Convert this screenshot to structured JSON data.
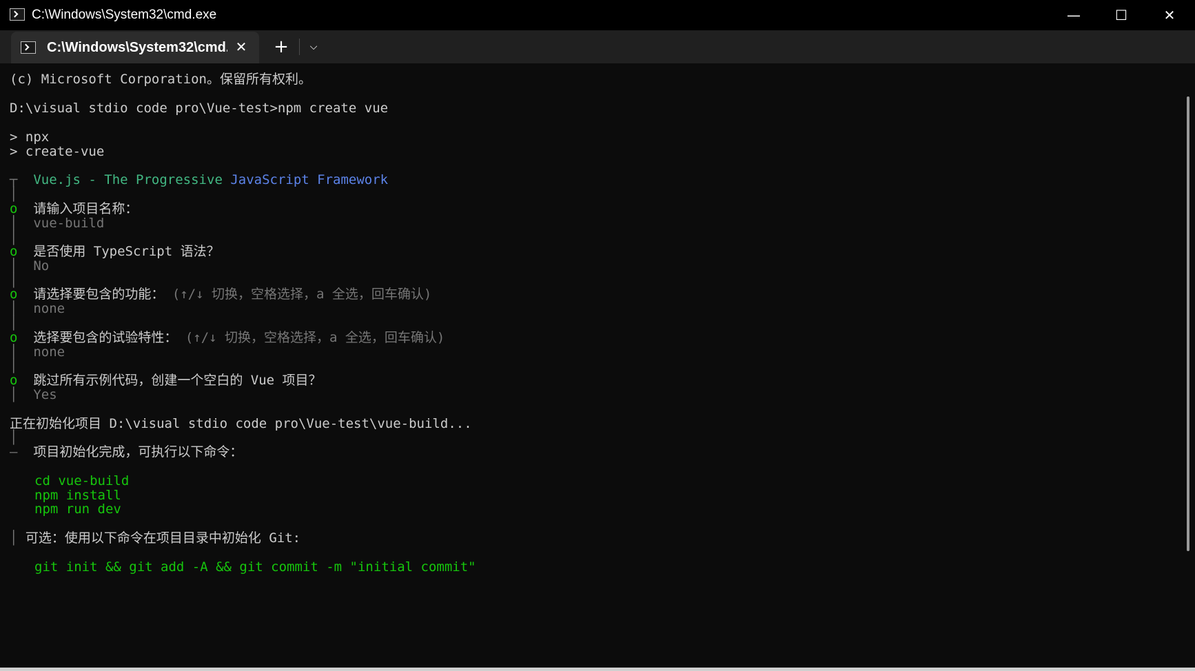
{
  "window": {
    "title": "C:\\Windows\\System32\\cmd.exe",
    "icon": "terminal-icon",
    "minimize_glyph": "—",
    "maximize_glyph": "☐",
    "close_glyph": "✕"
  },
  "tabs": {
    "active": {
      "label": "C:\\Windows\\System32\\cmd.exe",
      "icon": "terminal-icon",
      "close_glyph": "✕"
    },
    "new_tab_glyph": "+",
    "dropdown_glyph": "⌵"
  },
  "colors": {
    "background": "#0c0c0c",
    "text": "#cccccc",
    "green": "#16c60c",
    "dim": "#767676",
    "vue_green": "#42b883",
    "vue_blue": "#5c83e8"
  },
  "terminal": {
    "copyright": "(c) Microsoft Corporation。保留所有权利。",
    "prompt": "D:\\visual stdio code pro\\Vue-test>npm create vue",
    "npx_line1": "> npx",
    "npx_line2": "> create-vue",
    "banner_prefix": "┬ ",
    "banner_a": "Vue.js - The Progressive ",
    "banner_b": "JavaScript Framework",
    "bar": "│",
    "bullet": "o",
    "q1": "请输入项目名称：",
    "a1": "vue-build",
    "q2": "是否使用 TypeScript 语法？",
    "a2": "No",
    "q3": "请选择要包含的功能：",
    "q3_hint": "(↑/↓ 切换，空格选择，a 全选，回车确认)",
    "a3": "none",
    "q4": "选择要包含的试验特性：",
    "q4_hint": "(↑/↓ 切换，空格选择，a 全选，回车确认)",
    "a4": "none",
    "q5": "跳过所有示例代码，创建一个空白的 Vue 项目？",
    "a5": "Yes",
    "init_line": "正在初始化项目 D:\\visual stdio code pro\\Vue-test\\vue-build...",
    "done_prefix": "—",
    "done_line": "项目初始化完成，可执行以下命令：",
    "cmd1": "cd vue-build",
    "cmd2": "npm install",
    "cmd3": "npm run dev",
    "optional_line": "可选：使用以下命令在项目目录中初始化 Git:",
    "git_cmd": "git init && git add -A && git commit -m \"initial commit\""
  }
}
